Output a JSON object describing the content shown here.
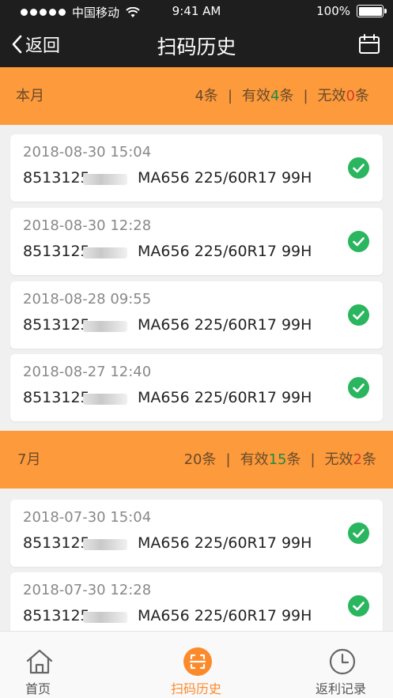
{
  "status_bar": {
    "carrier": "中国移动",
    "time": "9:41 AM",
    "battery": "100%"
  },
  "nav": {
    "back_label": "返回",
    "title": "扫码历史",
    "right_icon": "calendar-icon"
  },
  "sections": [
    {
      "month": "本月",
      "total": "4条",
      "valid_prefix": "有效",
      "valid_count": "4",
      "valid_suffix": "条",
      "invalid_prefix": "无效",
      "invalid_count": "0",
      "invalid_suffix": "条",
      "records": [
        {
          "date": "2018-08-30 15:04",
          "code": "8513125",
          "model": "MA656 225/60R17 99H",
          "status": "valid"
        },
        {
          "date": "2018-08-30 12:28",
          "code": "8513125",
          "model": "MA656 225/60R17 99H",
          "status": "valid"
        },
        {
          "date": "2018-08-28 09:55",
          "code": "8513125",
          "model": "MA656 225/60R17 99H",
          "status": "valid"
        },
        {
          "date": "2018-08-27 12:40",
          "code": "8513125",
          "model": "MA656 225/60R17 99H",
          "status": "valid"
        }
      ]
    },
    {
      "month": "7月",
      "total": "20条",
      "valid_prefix": "有效",
      "valid_count": "15",
      "valid_suffix": "条",
      "invalid_prefix": "无效",
      "invalid_count": "2",
      "invalid_suffix": "条",
      "records": [
        {
          "date": "2018-07-30 15:04",
          "code": "8513125",
          "model": "MA656 225/60R17 99H",
          "status": "valid"
        },
        {
          "date": "2018-07-30 12:28",
          "code": "8513125",
          "model": "MA656 225/60R17 99H",
          "status": "valid"
        }
      ]
    }
  ],
  "tabs": [
    {
      "label": "首页",
      "icon": "home-icon",
      "active": false
    },
    {
      "label": "扫码历史",
      "icon": "scan-icon",
      "active": true
    },
    {
      "label": "返利记录",
      "icon": "clock-icon",
      "active": false
    }
  ],
  "colors": {
    "accent": "#fc9a3c",
    "valid": "#2ab55f",
    "valid_text": "#1d8a46",
    "invalid_text": "#d43a2a",
    "bar": "#1e1e1e"
  }
}
